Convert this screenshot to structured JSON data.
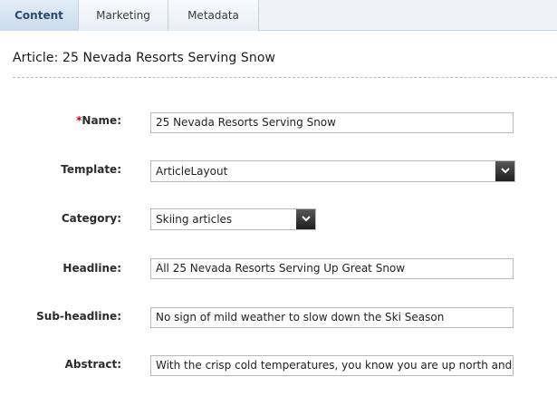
{
  "tabs": [
    {
      "label": "Content",
      "active": true
    },
    {
      "label": "Marketing",
      "active": false
    },
    {
      "label": "Metadata",
      "active": false
    }
  ],
  "article": {
    "title": "Article: 25 Nevada Resorts Serving Snow"
  },
  "form": {
    "name": {
      "required_marker": "*",
      "label": "Name:",
      "value": "25 Nevada Resorts Serving Snow"
    },
    "template": {
      "label": "Template:",
      "value": "ArticleLayout"
    },
    "category": {
      "label": "Category:",
      "value": "Skiing articles"
    },
    "headline": {
      "label": "Headline:",
      "value": "All 25 Nevada Resorts Serving Up Great Snow"
    },
    "subheadline": {
      "label": "Sub-headline:",
      "value": "No sign of mild weather to slow down the Ski Season"
    },
    "abstract": {
      "label": "Abstract:",
      "value": "With the crisp cold temperatures, you know you are up north and r"
    }
  },
  "colors": {
    "active_tab_bg": "#c9dbec",
    "tab_bar_bg": "#eef3f8",
    "required_marker": "#cc0000",
    "dropdown_button": "#1c1c1c"
  },
  "icons": {
    "dropdown": "chevron-down-icon"
  }
}
